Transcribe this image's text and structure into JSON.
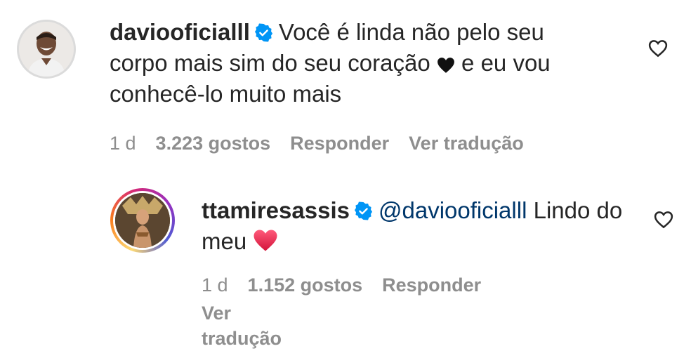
{
  "comments": [
    {
      "username": "daviooficialll",
      "verified": true,
      "text": "Você é linda não pelo seu corpo mais sim do seu coração",
      "text_after": "e eu vou conhecê-lo muito mais",
      "inline_icon": "black-heart-icon",
      "time": "1 d",
      "likes": "3.223 gostos",
      "reply_label": "Responder",
      "translate_label": "Ver tradução"
    },
    {
      "username": "ttamiresassis",
      "verified": true,
      "mention": "@daviooficialll",
      "text": "Lindo do meu",
      "inline_icon": "red-heart-icon",
      "time": "1 d",
      "likes": "1.152 gostos",
      "reply_label": "Responder",
      "translate_label": "Ver tradução"
    }
  ],
  "colors": {
    "text": "#262626",
    "meta": "#8e8e8e",
    "mention": "#00376b",
    "verified": "#0095f6",
    "red_heart": "#e0245e"
  }
}
